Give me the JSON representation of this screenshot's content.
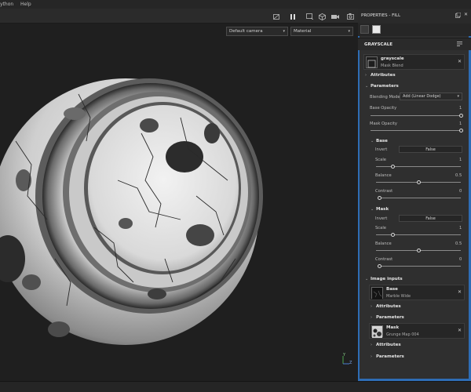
{
  "menubar": {
    "items": [
      "ython",
      "Help"
    ]
  },
  "viewport": {
    "camera_select": "Default camera",
    "material_select": "Material",
    "toolbar_icons": [
      "hide-icon",
      "pause-icon",
      "frame-icon",
      "cube-icon",
      "camera-icon",
      "screenshot-icon"
    ],
    "axis": {
      "y": "Y",
      "z": "Z"
    }
  },
  "panel": {
    "title": "PROPERTIES - FILL",
    "section_title": "GRAYSCALE",
    "filter": {
      "name": "grayscale",
      "subtitle": "Mask Blend"
    },
    "attributes_label": "Attributes",
    "parameters_label": "Parameters",
    "blending_mode_label": "Blending Mode",
    "blending_mode_value": "Add (Linear Dodge)",
    "base_opacity_label": "Base Opacity",
    "base_opacity_value": "1",
    "base_opacity_level": 1.0,
    "mask_opacity_label": "Mask Opacity",
    "mask_opacity_value": "1",
    "mask_opacity_level": 1.0,
    "base": {
      "title": "Base",
      "invert_label": "Invert",
      "invert_value": "False",
      "scale_label": "Scale",
      "scale_value": "1",
      "scale_level": 0.2,
      "balance_label": "Balance",
      "balance_value": "0.5",
      "balance_level": 0.5,
      "contrast_label": "Contrast",
      "contrast_value": "0",
      "contrast_level": 0.0
    },
    "mask": {
      "title": "Mask",
      "invert_label": "Invert",
      "invert_value": "False",
      "scale_label": "Scale",
      "scale_value": "1",
      "scale_level": 0.2,
      "balance_label": "Balance",
      "balance_value": "0.5",
      "balance_level": 0.5,
      "contrast_label": "Contrast",
      "contrast_value": "0",
      "contrast_level": 0.0
    },
    "image_inputs_label": "Image inputs",
    "input_base": {
      "name": "Base",
      "resource": "Marble Wide"
    },
    "input_mask": {
      "name": "Mask",
      "resource": "Grunge Map 004"
    },
    "close_glyph": "✕"
  }
}
